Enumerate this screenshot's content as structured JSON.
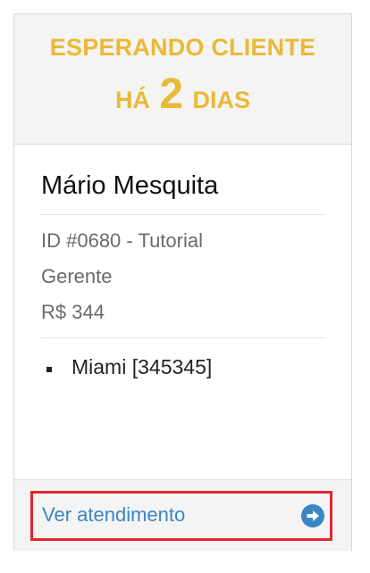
{
  "header": {
    "status_line": "ESPERANDO CLIENTE",
    "waiting_prefix": "HÁ",
    "waiting_count": "2",
    "waiting_unit": "DIAS"
  },
  "client": {
    "name": "Mário Mesquita",
    "id_line": "ID #0680 - Tutorial",
    "role": "Gerente",
    "amount": "R$ 344"
  },
  "locations": [
    "Miami [345345]"
  ],
  "footer": {
    "link_label": "Ver atendimento",
    "link_icon": "circle-arrow-right-icon"
  },
  "colors": {
    "accent_yellow": "#eab936",
    "link_blue": "#3a86c4",
    "highlight_red": "#e3262c"
  }
}
